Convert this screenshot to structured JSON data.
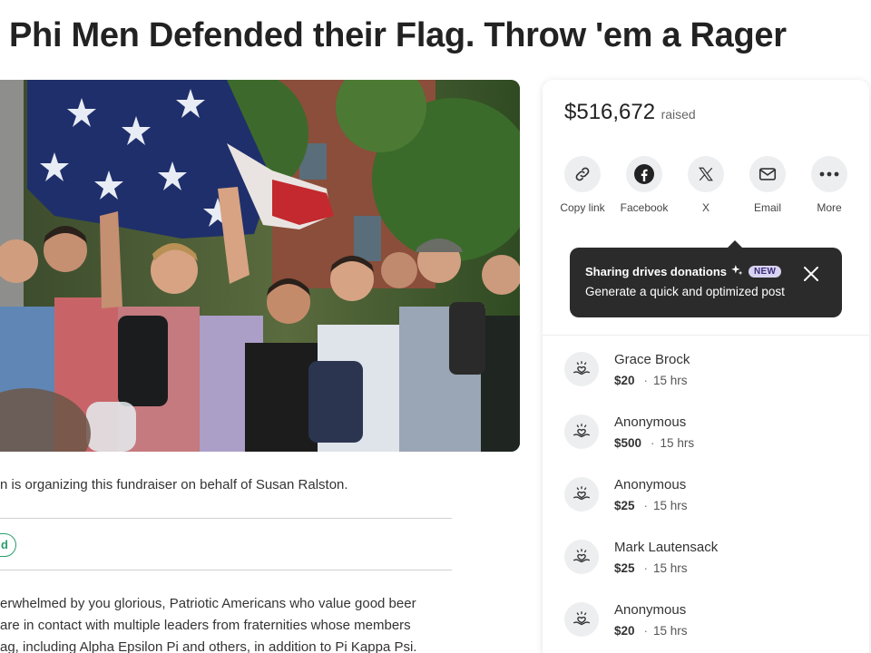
{
  "page": {
    "title": "Phi Men Defended their Flag. Throw 'em a Rager"
  },
  "hero": {
    "alt": "Students holding an American flag"
  },
  "fundraiser": {
    "organizer_text": "n is organizing this fundraiser on behalf of Susan Ralston.",
    "badge_fragment": "d",
    "story_lines": [
      "erwhelmed by you glorious, Patriotic Americans who value good beer",
      "are in contact with multiple leaders from fraternities whose members",
      "ag, including Alpha Epsilon Pi and others, in addition to Pi Kappa Psi."
    ]
  },
  "donation_card": {
    "raised_amount": "$516,672",
    "raised_label": "raised",
    "share_buttons": [
      {
        "label": "Copy link",
        "icon": "link-icon"
      },
      {
        "label": "Facebook",
        "icon": "facebook-icon"
      },
      {
        "label": "X",
        "icon": "x-logo-icon"
      },
      {
        "label": "Email",
        "icon": "email-icon"
      },
      {
        "label": "More",
        "icon": "more-icon"
      }
    ],
    "tooltip": {
      "title": "Sharing drives donations",
      "badge": "NEW",
      "body": "Generate a quick and optimized post"
    },
    "donations": [
      {
        "name": "Grace Brock",
        "amount": "$20",
        "time": "15 hrs"
      },
      {
        "name": "Anonymous",
        "amount": "$500",
        "time": "15 hrs"
      },
      {
        "name": "Anonymous",
        "amount": "$25",
        "time": "15 hrs"
      },
      {
        "name": "Mark Lautensack",
        "amount": "$25",
        "time": "15 hrs"
      },
      {
        "name": "Anonymous",
        "amount": "$20",
        "time": "15 hrs"
      }
    ]
  },
  "colors": {
    "accent_green": "#2a9d6b",
    "tooltip_bg": "#2b2b2b",
    "new_badge_bg": "#d9d3f2"
  }
}
